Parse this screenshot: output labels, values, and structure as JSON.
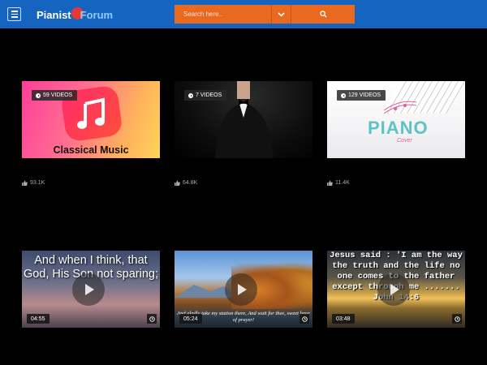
{
  "header": {
    "logo_text_1": "Pianist",
    "logo_text_2": "Forum",
    "search_placeholder": "Search here..",
    "accent_color": "#1565c0",
    "search_color": "#e8691f"
  },
  "playlists": [
    {
      "count_label": "59 VIDEOS",
      "likes": "93.1K",
      "title_art": "Classical Music"
    },
    {
      "count_label": "7 VIDEOS",
      "likes": "64.8K"
    },
    {
      "count_label": "129 VIDEOS",
      "likes": "11.4K",
      "title_art": "PIANO",
      "sub_art": "Cover"
    }
  ],
  "videos": [
    {
      "duration": "04:55",
      "overlay": "And when I think, that God, His Son not sparing;"
    },
    {
      "duration": "05:24",
      "overlay": "And gladly take my station there, And wait for thee, sweet hour of prayer!"
    },
    {
      "duration": "03:48",
      "overlay": "Jesus said : 'I am the way the truth and the life no one comes to the father except through me ....... John 14:6"
    }
  ]
}
